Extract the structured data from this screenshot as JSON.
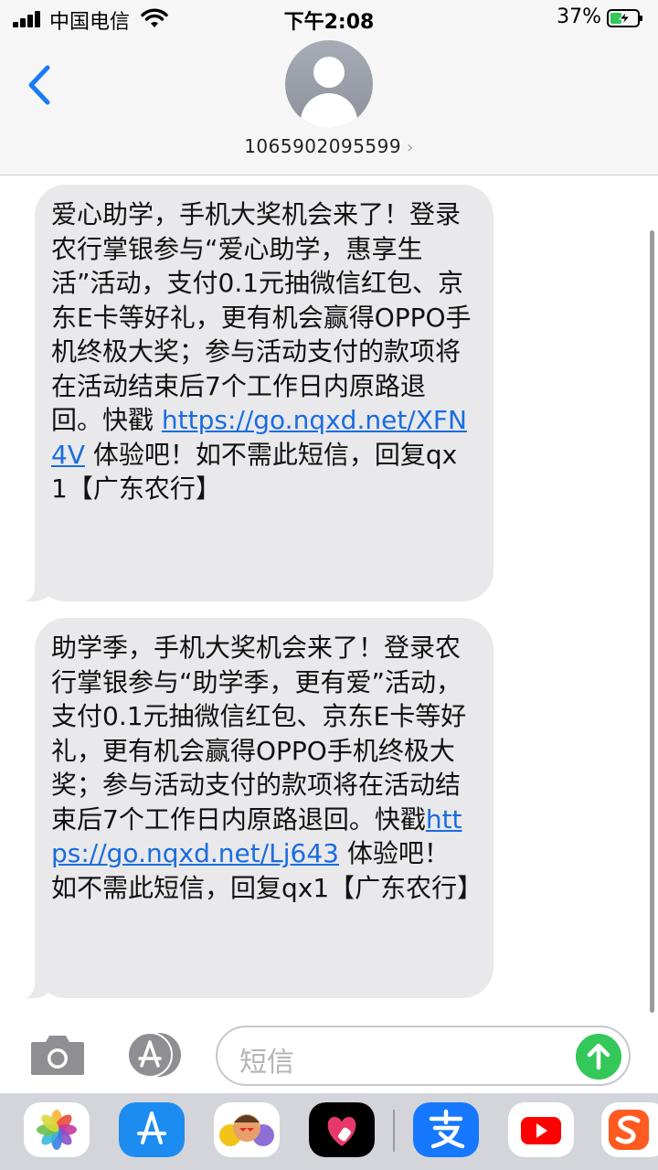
{
  "status_bar": {
    "carrier": "中国电信",
    "time": "下午2:08",
    "battery_percent": "37%"
  },
  "header": {
    "contact": "1065902095599",
    "back_icon": "chevron-left-icon",
    "avatar_icon": "person-icon"
  },
  "messages": [
    {
      "text_before": "爱心助学，手机大奖机会来了！登录农行掌银参与“爱心助学，惠享生活”活动，支付0.1元抽微信红包、京东E卡等好礼，更有机会赢得OPPO手机终极大奖；参与活动支付的款项将在活动结束后7个工作日内原路退回。快戳 ",
      "link": "https://go.nqxd.net/XFN4V",
      "text_after": " 体验吧！如不需此短信，回复qx1【广东农行】"
    },
    {
      "text_before": "助学季，手机大奖机会来了！登录农行掌银参与“助学季，更有爱”活动，支付0.1元抽微信红包、京东E卡等好礼，更有机会赢得OPPO手机终极大奖；参与活动支付的款项将在活动结束后7个工作日内原路退回。快戳",
      "link": "https://go.nqxd.net/Lj643",
      "text_after": " 体验吧！如不需此短信，回复qx1【广东农行】"
    }
  ],
  "composer": {
    "placeholder": "短信",
    "camera_icon": "camera-icon",
    "apps_icon": "app-store-icon",
    "send_icon": "arrow-up-icon"
  },
  "app_drawer": [
    "photos-icon",
    "app-store-icon",
    "memoji-icon",
    "digital-touch-icon",
    "alipay-icon",
    "youtube-icon",
    "sogou-icon"
  ],
  "colors": {
    "bubble": "#e9e9eb",
    "link": "#1a6ce0",
    "send": "#34c759",
    "back": "#1a7cf5"
  }
}
